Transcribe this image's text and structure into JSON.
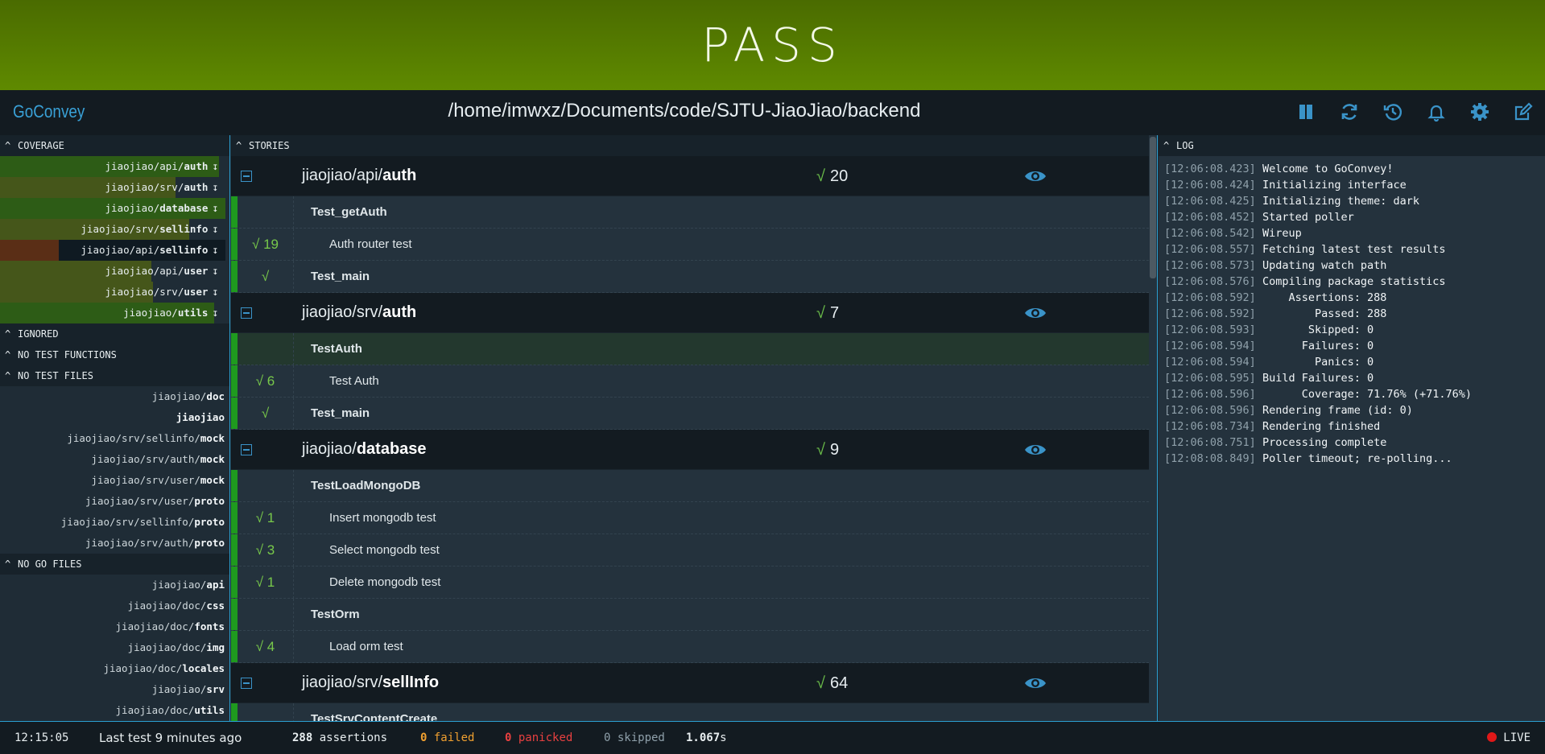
{
  "banner": {
    "status": "PASS"
  },
  "topbar": {
    "brand": "GoConvey",
    "path": "/home/imwxz/Documents/code/SJTU-JiaoJiao/backend"
  },
  "toolbar": {
    "icons": [
      "pause-icon",
      "refresh-icon",
      "history-icon",
      "notifications-icon",
      "settings-icon",
      "edit-icon"
    ]
  },
  "coverage": {
    "heading": "COVERAGE",
    "items": [
      {
        "prefix": "jiaojiao/api/",
        "name": "auth",
        "arrow": "↧",
        "percent": 97
      },
      {
        "prefix": "jiaojiao/srv/",
        "name": "auth",
        "arrow": "↧",
        "percent": 78
      },
      {
        "prefix": "jiaojiao/",
        "name": "database",
        "arrow": "↧",
        "percent": 100
      },
      {
        "prefix": "jiaojiao/srv/",
        "name": "sellinfo",
        "arrow": "↧",
        "percent": 84
      },
      {
        "prefix": "jiaojiao/api/",
        "name": "sellinfo",
        "arrow": "↧",
        "percent": 26
      },
      {
        "prefix": "jiaojiao/api/",
        "name": "user",
        "arrow": "↧",
        "percent": 67
      },
      {
        "prefix": "jiaojiao/srv/",
        "name": "user",
        "arrow": "↧",
        "percent": 68
      },
      {
        "prefix": "jiaojiao/",
        "name": "utils",
        "arrow": "↧",
        "percent": 95
      }
    ]
  },
  "ignored": {
    "heading": "IGNORED"
  },
  "no_test_functions": {
    "heading": "NO TEST FUNCTIONS"
  },
  "no_test_files": {
    "heading": "NO TEST FILES",
    "items": [
      {
        "prefix": "jiaojiao/",
        "name": "doc"
      },
      {
        "prefix": "",
        "name": "jiaojiao"
      },
      {
        "prefix": "jiaojiao/srv/sellinfo/",
        "name": "mock"
      },
      {
        "prefix": "jiaojiao/srv/auth/",
        "name": "mock"
      },
      {
        "prefix": "jiaojiao/srv/user/",
        "name": "mock"
      },
      {
        "prefix": "jiaojiao/srv/user/",
        "name": "proto"
      },
      {
        "prefix": "jiaojiao/srv/sellinfo/",
        "name": "proto"
      },
      {
        "prefix": "jiaojiao/srv/auth/",
        "name": "proto"
      }
    ]
  },
  "no_go_files": {
    "heading": "NO GO FILES",
    "items": [
      {
        "prefix": "jiaojiao/",
        "name": "api"
      },
      {
        "prefix": "jiaojiao/doc/",
        "name": "css"
      },
      {
        "prefix": "jiaojiao/doc/",
        "name": "fonts"
      },
      {
        "prefix": "jiaojiao/doc/",
        "name": "img"
      },
      {
        "prefix": "jiaojiao/doc/",
        "name": "locales"
      },
      {
        "prefix": "jiaojiao/",
        "name": "srv"
      },
      {
        "prefix": "jiaojiao/doc/",
        "name": "utils"
      }
    ]
  },
  "stories": {
    "heading": "STORIES",
    "check": "√",
    "packages": [
      {
        "prefix": "jiaojiao/api/",
        "name": "auth",
        "count": "20",
        "lines": [
          {
            "kind": "test",
            "label": "Test_getAuth",
            "result": ""
          },
          {
            "kind": "assert",
            "label": "Auth router test",
            "result": "√ 19"
          },
          {
            "kind": "test",
            "label": "Test_main",
            "result": "√"
          }
        ]
      },
      {
        "prefix": "jiaojiao/srv/",
        "name": "auth",
        "count": "7",
        "lines": [
          {
            "kind": "test",
            "label": "TestAuth",
            "result": "",
            "highlight": true
          },
          {
            "kind": "assert",
            "label": "Test Auth",
            "result": "√ 6"
          },
          {
            "kind": "test",
            "label": "Test_main",
            "result": "√"
          }
        ]
      },
      {
        "prefix": "jiaojiao/",
        "name": "database",
        "count": "9",
        "lines": [
          {
            "kind": "test",
            "label": "TestLoadMongoDB",
            "result": ""
          },
          {
            "kind": "assert",
            "label": "Insert mongodb test",
            "result": "√ 1"
          },
          {
            "kind": "assert",
            "label": "Select mongodb test",
            "result": "√ 3"
          },
          {
            "kind": "assert",
            "label": "Delete mongodb test",
            "result": "√ 1"
          },
          {
            "kind": "test",
            "label": "TestOrm",
            "result": ""
          },
          {
            "kind": "assert",
            "label": "Load orm test",
            "result": "√ 4"
          }
        ]
      },
      {
        "prefix": "jiaojiao/srv/",
        "name": "sellInfo",
        "count": "64",
        "lines": [
          {
            "kind": "test",
            "label": "TestSrvContentCreate",
            "result": ""
          }
        ]
      }
    ]
  },
  "log": {
    "heading": "LOG",
    "entries": [
      {
        "ts": "[12:06:08.423]",
        "msg": "Welcome to GoConvey!"
      },
      {
        "ts": "[12:06:08.424]",
        "msg": "Initializing interface"
      },
      {
        "ts": "[12:06:08.425]",
        "msg": "Initializing theme: dark"
      },
      {
        "ts": "[12:06:08.452]",
        "msg": "Started poller"
      },
      {
        "ts": "[12:06:08.542]",
        "msg": "Wireup"
      },
      {
        "ts": "[12:06:08.557]",
        "msg": "Fetching latest test results"
      },
      {
        "ts": "[12:06:08.573]",
        "msg": "Updating watch path"
      },
      {
        "ts": "[12:06:08.576]",
        "msg": "Compiling package statistics"
      },
      {
        "ts": "[12:06:08.592]",
        "msg": "    Assertions: 288"
      },
      {
        "ts": "[12:06:08.592]",
        "msg": "        Passed: 288"
      },
      {
        "ts": "[12:06:08.593]",
        "msg": "       Skipped: 0"
      },
      {
        "ts": "[12:06:08.594]",
        "msg": "      Failures: 0"
      },
      {
        "ts": "[12:06:08.594]",
        "msg": "        Panics: 0"
      },
      {
        "ts": "[12:06:08.595]",
        "msg": "Build Failures: 0"
      },
      {
        "ts": "[12:06:08.596]",
        "msg": "      Coverage: 71.76% (+71.76%)"
      },
      {
        "ts": "[12:06:08.596]",
        "msg": "Rendering frame (id: 0)"
      },
      {
        "ts": "[12:06:08.734]",
        "msg": "Rendering finished"
      },
      {
        "ts": "[12:06:08.751]",
        "msg": "Processing complete"
      },
      {
        "ts": "[12:08:08.849]",
        "msg": "Poller timeout; re-polling..."
      }
    ]
  },
  "footer": {
    "clock": "12:15:05",
    "last_test": "Last test 9 minutes ago",
    "assertions_count": "288",
    "assertions_label": " assertions",
    "failed_count": "0",
    "failed_label": " failed",
    "panicked_count": "0",
    "panicked_label": " panicked",
    "skipped": "0 skipped",
    "duration_value": "1.067",
    "duration_unit": "s",
    "live": "LIVE"
  },
  "colors": {
    "pass_banner": "#5f8a00",
    "accent": "#3a93c8",
    "pass_green": "#1f9a1f",
    "check_green": "#6cc04a"
  }
}
